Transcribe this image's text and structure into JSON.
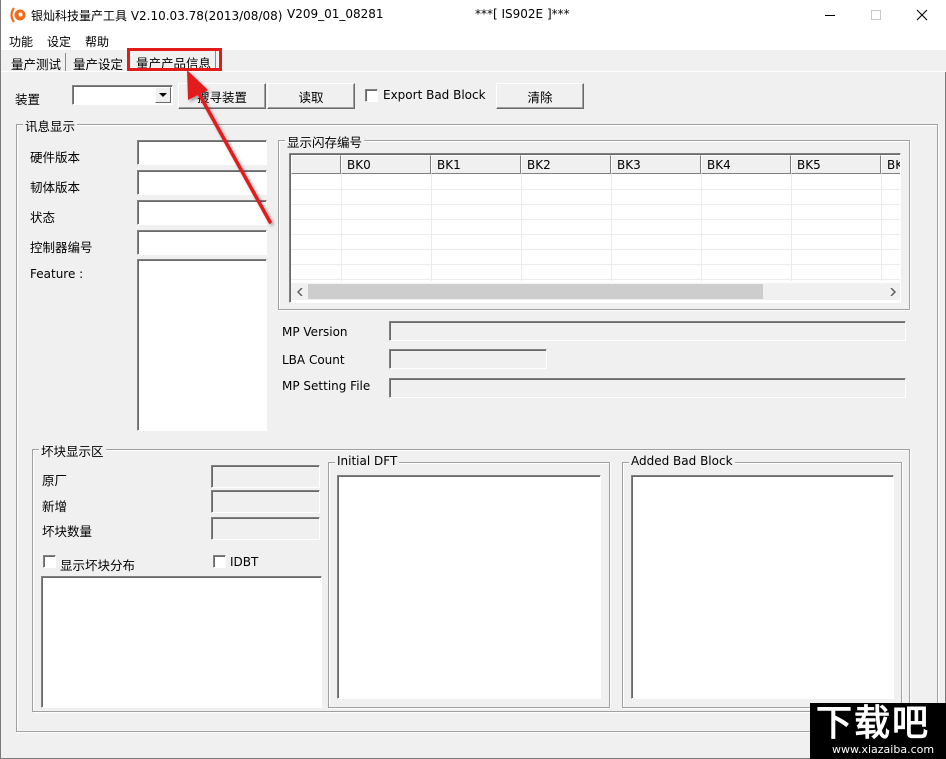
{
  "window": {
    "title": "银灿科技量产工具 V2.10.03.78(2013/08/08)",
    "version_code": "V209_01_08281",
    "device_tag": "***[ IS902E ]***",
    "controls": {
      "minimize": "minimize",
      "maximize": "maximize",
      "close": "close"
    }
  },
  "menu": {
    "items": [
      {
        "label": "功能"
      },
      {
        "label": "设定"
      },
      {
        "label": "帮助"
      }
    ]
  },
  "tabs": [
    {
      "label": "量产测试",
      "active": false
    },
    {
      "label": "量产设定",
      "active": false
    },
    {
      "label": "量产产品信息",
      "active": true,
      "highlighted": true
    }
  ],
  "toolbar": {
    "device_label": "装置",
    "device_combo_value": "",
    "search_button": "搜寻装置",
    "read_button": "读取",
    "export_bad_block": {
      "label": "Export Bad Block",
      "checked": false
    },
    "clear_button": "清除"
  },
  "info_panel": {
    "title": "讯息显示",
    "fields": [
      {
        "label": "硬件版本",
        "value": ""
      },
      {
        "label": "韧体版本",
        "value": ""
      },
      {
        "label": "状态",
        "value": ""
      },
      {
        "label": "控制器编号",
        "value": ""
      }
    ],
    "feature_label": "Feature :",
    "feature_value": ""
  },
  "flash_panel": {
    "title": "显示闪存编号",
    "columns": [
      "",
      "BK0",
      "BK1",
      "BK2",
      "BK3",
      "BK4",
      "BK5",
      "BK"
    ],
    "rows": [
      [],
      [],
      [],
      [],
      [],
      [],
      []
    ]
  },
  "mp_info": {
    "mp_version": {
      "label": "MP Version",
      "value": ""
    },
    "lba_count": {
      "label": "LBA Count",
      "value": ""
    },
    "mp_setting_file": {
      "label": "MP Setting File",
      "value": ""
    }
  },
  "bad_block_panel": {
    "title": "坏块显示区",
    "fields": [
      {
        "label": "原厂",
        "value": ""
      },
      {
        "label": "新增",
        "value": ""
      },
      {
        "label": "坏块数量",
        "value": ""
      }
    ],
    "show_distribution": {
      "label": "显示坏块分布",
      "checked": false
    },
    "idbt": {
      "label": "IDBT",
      "checked": false
    },
    "distribution_value": "",
    "initial_dft": {
      "title": "Initial DFT",
      "value": ""
    },
    "added_bad_block": {
      "title": "Added Bad Block",
      "value": ""
    }
  },
  "annotation": {
    "color": "#e21a1a"
  },
  "watermark": {
    "text": "下载吧",
    "url": "www.xiazaiba.com"
  }
}
